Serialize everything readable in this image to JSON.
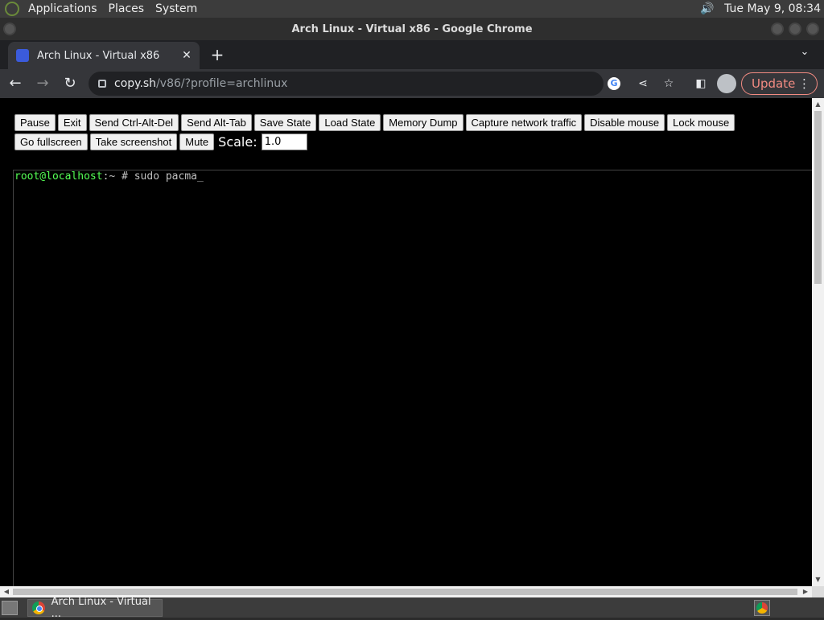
{
  "top_panel": {
    "menus": [
      "Applications",
      "Places",
      "System"
    ],
    "clock": "Tue May  9, 08:34"
  },
  "window": {
    "title": "Arch Linux - Virtual x86 - Google Chrome"
  },
  "tab": {
    "title": "Arch Linux - Virtual x86",
    "close_glyph": "✕",
    "new_tab_glyph": "+"
  },
  "toolbar": {
    "url_domain": "copy.sh",
    "url_path": "/v86/?profile=archlinux",
    "update_label": "Update"
  },
  "controls": {
    "buttons": [
      "Pause",
      "Exit",
      "Send Ctrl-Alt-Del",
      "Send Alt-Tab",
      "Save State",
      "Load State",
      "Memory Dump",
      "Capture network traffic",
      "Disable mouse",
      "Lock mouse",
      "Go fullscreen",
      "Take screenshot",
      "Mute"
    ],
    "scale_label": "Scale:",
    "scale_value": "1.0"
  },
  "terminal": {
    "prompt_user": "root@localhost",
    "prompt_sep": ":~",
    "command": "# sudo pacma_"
  },
  "taskbar": {
    "item_label": "Arch Linux - Virtual ..."
  }
}
